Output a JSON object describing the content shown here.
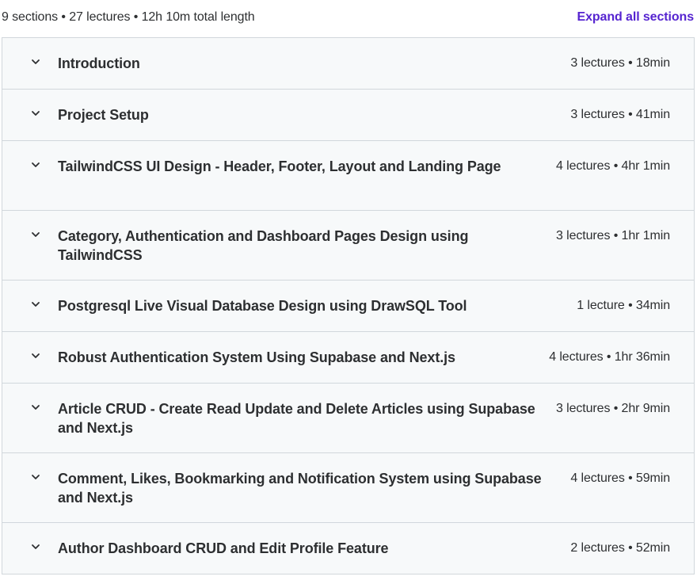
{
  "summary": {
    "text": "9 sections • 27 lectures • 12h 10m total length",
    "expand_label": "Expand all sections"
  },
  "sections": [
    {
      "title": "Introduction",
      "meta": "3 lectures • 18min",
      "single": true
    },
    {
      "title": "Project Setup",
      "meta": "3 lectures • 41min",
      "single": true
    },
    {
      "title": "TailwindCSS UI Design - Header, Footer, Layout and Landing Page",
      "meta": "4 lectures • 4hr 1min",
      "single": false
    },
    {
      "title": "Category, Authentication and Dashboard Pages Design using TailwindCSS",
      "meta": "3 lectures • 1hr 1min",
      "single": false
    },
    {
      "title": "Postgresql Live Visual Database Design using DrawSQL Tool",
      "meta": "1 lecture • 34min",
      "single": true
    },
    {
      "title": "Robust Authentication System Using Supabase and Next.js",
      "meta": "4 lectures • 1hr 36min",
      "single": true
    },
    {
      "title": "Article CRUD - Create Read Update and Delete Articles using Supabase and Next.js",
      "meta": "3 lectures • 2hr 9min",
      "single": false
    },
    {
      "title": "Comment, Likes, Bookmarking and Notification System using Supabase and Next.js",
      "meta": "4 lectures • 59min",
      "single": false
    },
    {
      "title": "Author Dashboard CRUD and Edit Profile Feature",
      "meta": "2 lectures • 52min",
      "single": true
    }
  ],
  "icons": {
    "chevron": "chevron-down-icon"
  }
}
